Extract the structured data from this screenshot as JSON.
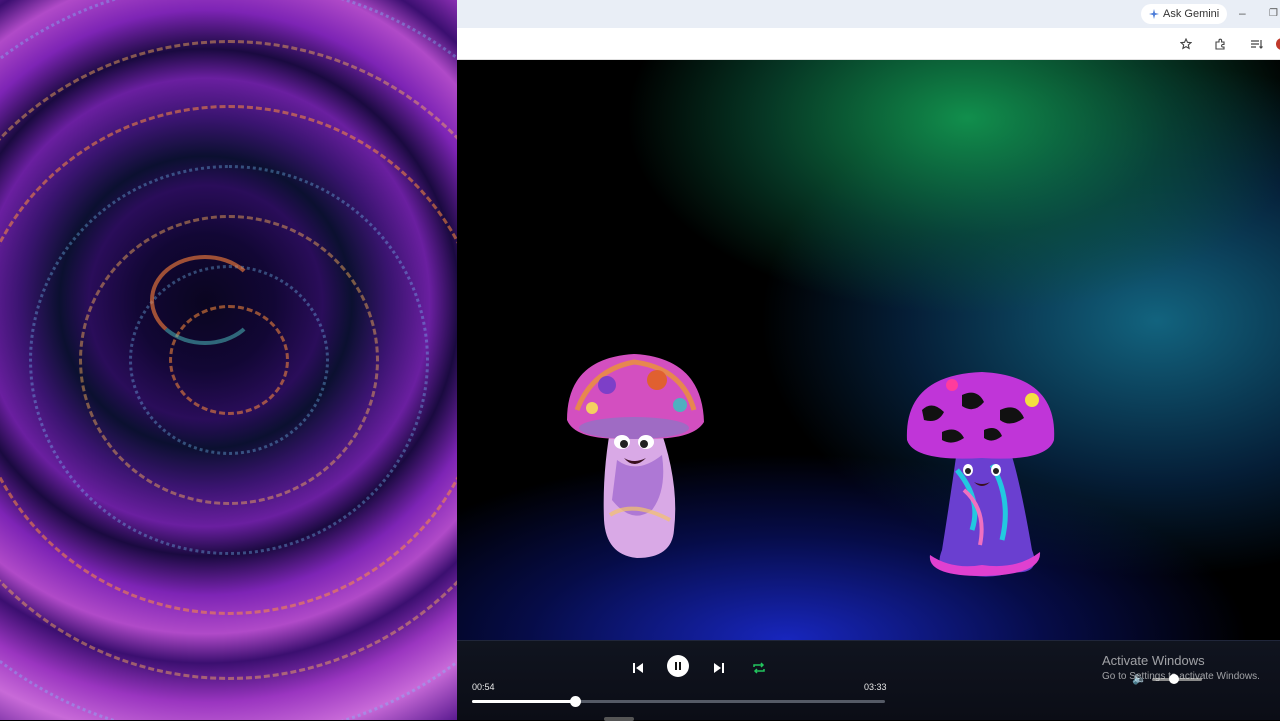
{
  "browser": {
    "ask_gemini_label": "Ask Gemini",
    "minimize_glyph": "–",
    "restore_glyph": "❐"
  },
  "player": {
    "current_time": "00:54",
    "duration": "03:33",
    "progress_fraction": 0.25,
    "volume_fraction": 0.4
  },
  "watermark": {
    "title": "Activate Windows",
    "subtitle": "Go to Settings to activate Windows."
  },
  "colors": {
    "repeat_accent": "#22c55e",
    "progress_fill": "#ffffff"
  },
  "icons": [
    "gemini-icon",
    "star-icon",
    "extension-icon",
    "reading-list-icon",
    "profile-icon",
    "previous-icon",
    "pause-icon",
    "next-icon",
    "repeat-icon",
    "volume-icon"
  ]
}
